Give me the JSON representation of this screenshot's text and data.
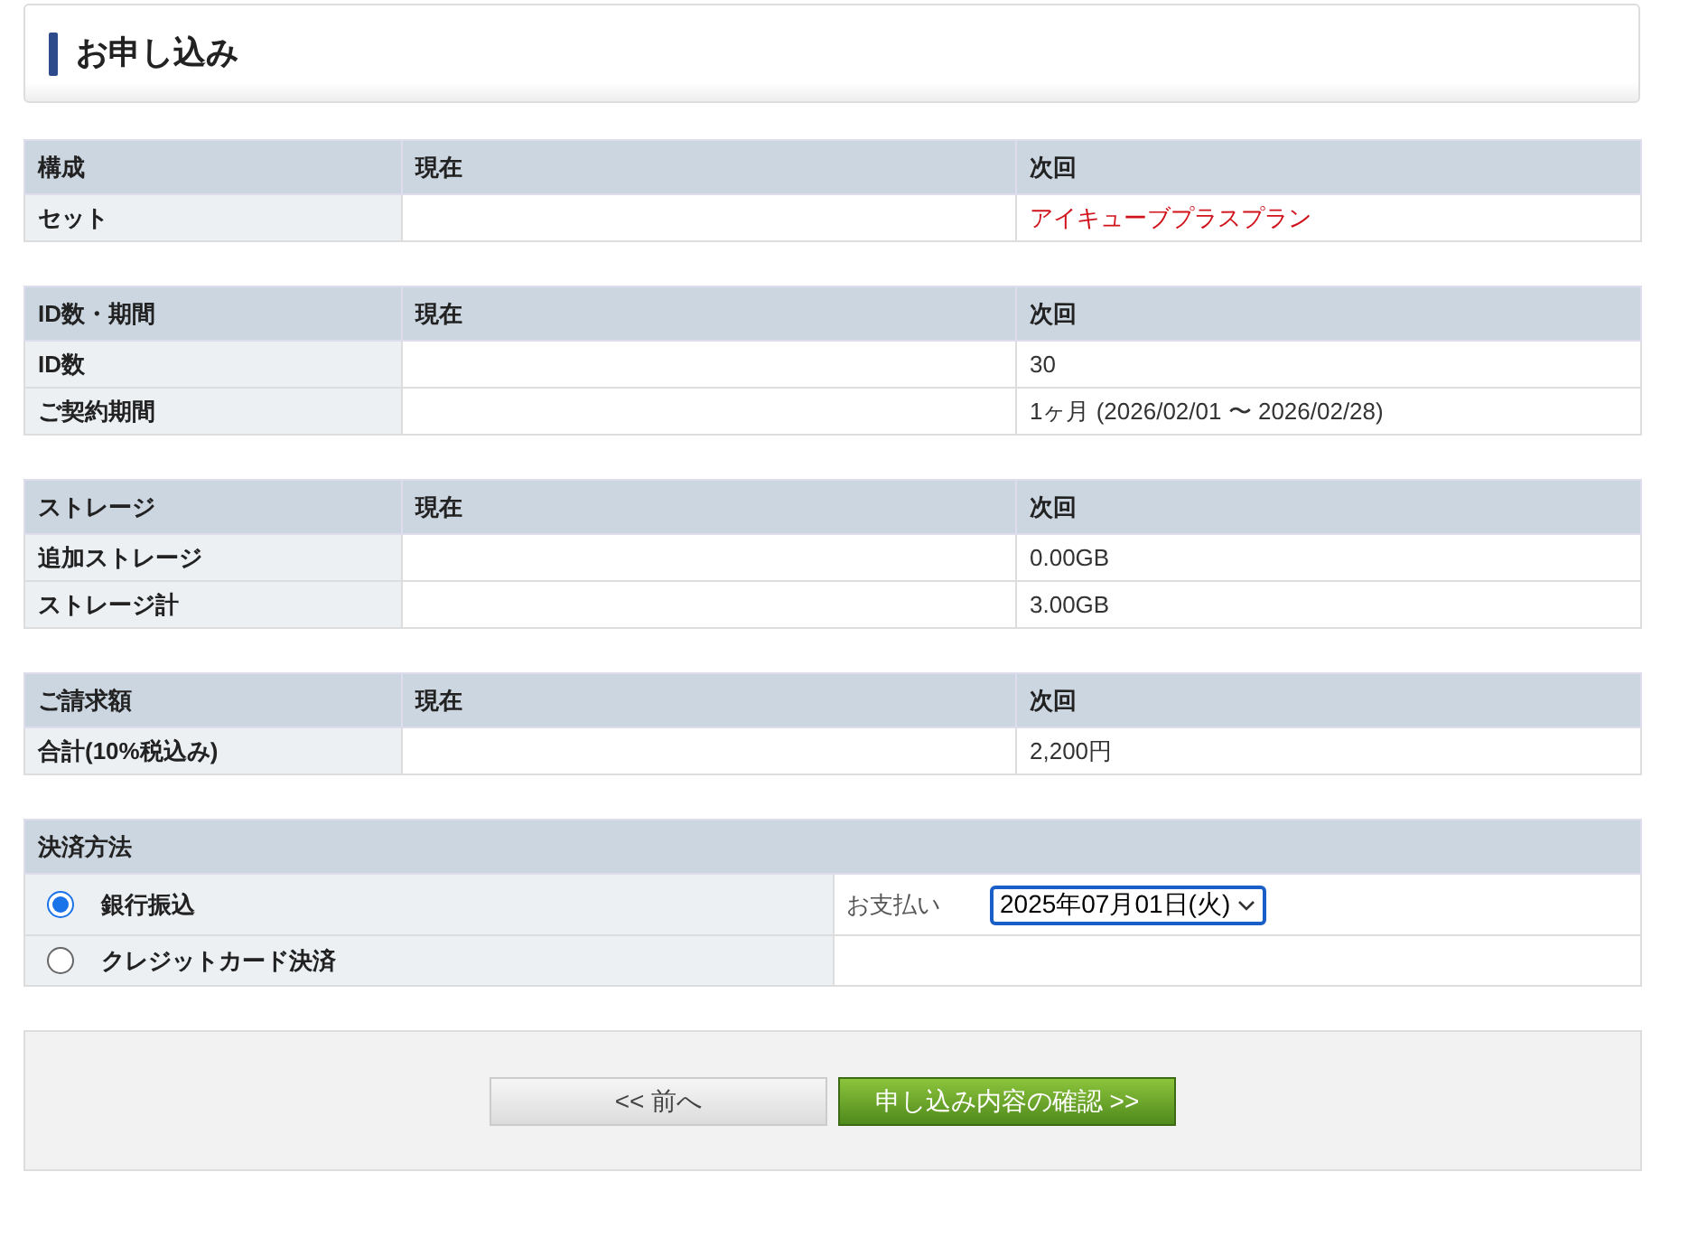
{
  "page_title": "お申し込み",
  "tables": [
    {
      "columns": [
        "構成",
        "現在",
        "次回"
      ],
      "rows": [
        {
          "label": "セット",
          "current": "",
          "next": "アイキューブプラスプラン",
          "emphasis": true
        }
      ]
    },
    {
      "columns": [
        "ID数・期間",
        "現在",
        "次回"
      ],
      "rows": [
        {
          "label": "ID数",
          "current": "",
          "next": "30",
          "emphasis": false
        },
        {
          "label": "ご契約期間",
          "current": "",
          "next": "1ヶ月 (2026/02/01 〜 2026/02/28)",
          "emphasis": false
        }
      ]
    },
    {
      "columns": [
        "ストレージ",
        "現在",
        "次回"
      ],
      "rows": [
        {
          "label": "追加ストレージ",
          "current": "",
          "next": "0.00GB",
          "emphasis": false
        },
        {
          "label": "ストレージ計",
          "current": "",
          "next": "3.00GB",
          "emphasis": false
        }
      ]
    },
    {
      "columns": [
        "ご請求額",
        "現在",
        "次回"
      ],
      "rows": [
        {
          "label": "合計(10%税込み)",
          "current": "",
          "next": "2,200円",
          "emphasis": false
        }
      ]
    }
  ],
  "payment": {
    "heading": "決済方法",
    "options": [
      {
        "label": "銀行振込",
        "selected": true,
        "detail_label": "お支払い",
        "date_value": "2025年07月01日(火)"
      },
      {
        "label": "クレジットカード決済",
        "selected": false
      }
    ]
  },
  "buttons": {
    "back": "<< 前へ",
    "confirm": "申し込み内容の確認 >>"
  }
}
